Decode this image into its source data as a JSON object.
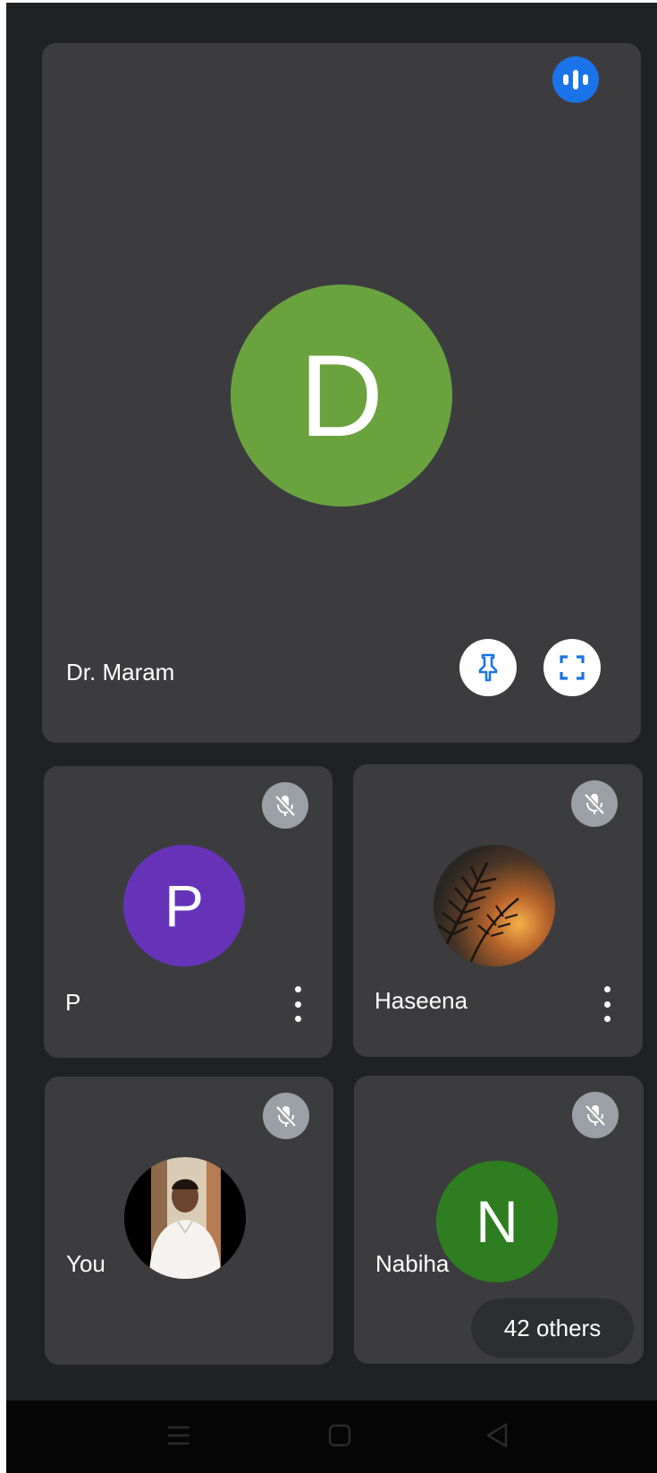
{
  "main": {
    "participant_name": "Dr. Maram",
    "avatar_initial": "D",
    "avatar_color": "#6aa33e",
    "speaking_icon": "audio-level-icon",
    "pin_icon": "pin-icon",
    "fullscreen_icon": "fullscreen-icon"
  },
  "participants": [
    {
      "name": "P",
      "avatar_initial": "P",
      "avatar_color": "#6633b8",
      "muted": true,
      "more_icon": "more-vert-icon"
    },
    {
      "name": "Haseena",
      "avatar_image": "sunset-fern-photo",
      "muted": true,
      "more_icon": "more-vert-icon"
    },
    {
      "name": "You",
      "avatar_image": "user-photo",
      "muted": true
    },
    {
      "name": "Nabiha",
      "avatar_initial": "N",
      "avatar_color": "#2e7d20",
      "muted": true
    }
  ],
  "others": {
    "label": "42 others"
  },
  "navbar": {
    "menu_icon": "menu-icon",
    "home_icon": "home-square-icon",
    "back_icon": "back-triangle-icon"
  }
}
